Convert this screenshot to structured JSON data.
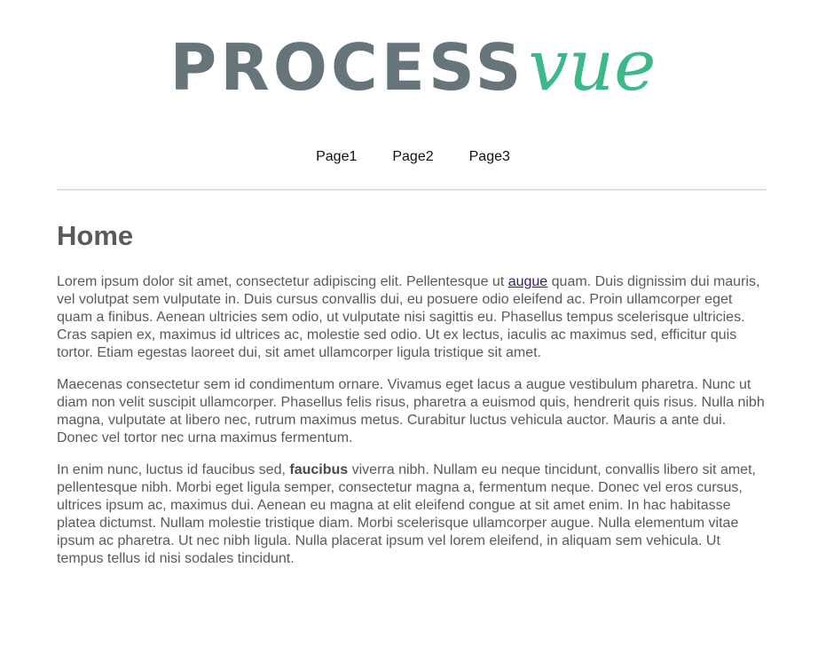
{
  "logo": {
    "part1": "PROCESS",
    "part2": "vue",
    "colors": {
      "part1": "#66757a",
      "part2": "#3db888"
    }
  },
  "nav": {
    "items": [
      {
        "label": "Page1"
      },
      {
        "label": "Page2"
      },
      {
        "label": "Page3"
      }
    ]
  },
  "main": {
    "title": "Home",
    "p1": {
      "before": "Lorem ipsum dolor sit amet, consectetur adipiscing elit. Pellentesque ut ",
      "link": "augue",
      "after": " quam. Duis dignissim dui mauris, vel volutpat sem vulputate in. Duis cursus convallis dui, eu posuere odio eleifend ac. Proin ullamcorper eget quam a finibus. Aenean ultricies sem odio, ut vulputate nisi sagittis eu. Phasellus tempus scelerisque ultricies. Cras sapien ex, maximus id ultrices ac, molestie sed odio. Ut ex lectus, iaculis ac maximus sed, efficitur quis tortor. Etiam egestas laoreet dui, sit amet ullamcorper ligula tristique sit amet."
    },
    "p2": "Maecenas consectetur sem id condimentum ornare. Vivamus eget lacus a augue vestibulum pharetra. Nunc ut diam non velit suscipit ullamcorper. Phasellus felis risus, pharetra a euismod quis, hendrerit quis risus. Nulla nibh magna, vulputate at libero nec, rutrum maximus metus. Curabitur luctus vehicula auctor. Mauris a ante dui. Donec vel tortor nec urna maximus fermentum.",
    "p3": {
      "before": "In enim nunc, luctus id faucibus sed, ",
      "bold": "faucibus",
      "after": " viverra nibh. Nullam eu neque tincidunt, convallis libero sit amet, pellentesque nibh. Morbi eget ligula semper, consectetur magna a, fermentum neque. Donec vel eros cursus, ultrices ipsum ac, maximus dui. Aenean eu magna at elit eleifend congue at sit amet enim. In hac habitasse platea dictumst. Nullam molestie tristique diam. Morbi scelerisque ullamcorper augue. Nulla elementum vitae ipsum ac pharetra. Ut nec nibh ligula. Nulla placerat ipsum vel lorem eleifend, in aliquam sem vehicula. Ut tempus tellus id nisi sodales tincidunt."
    }
  }
}
